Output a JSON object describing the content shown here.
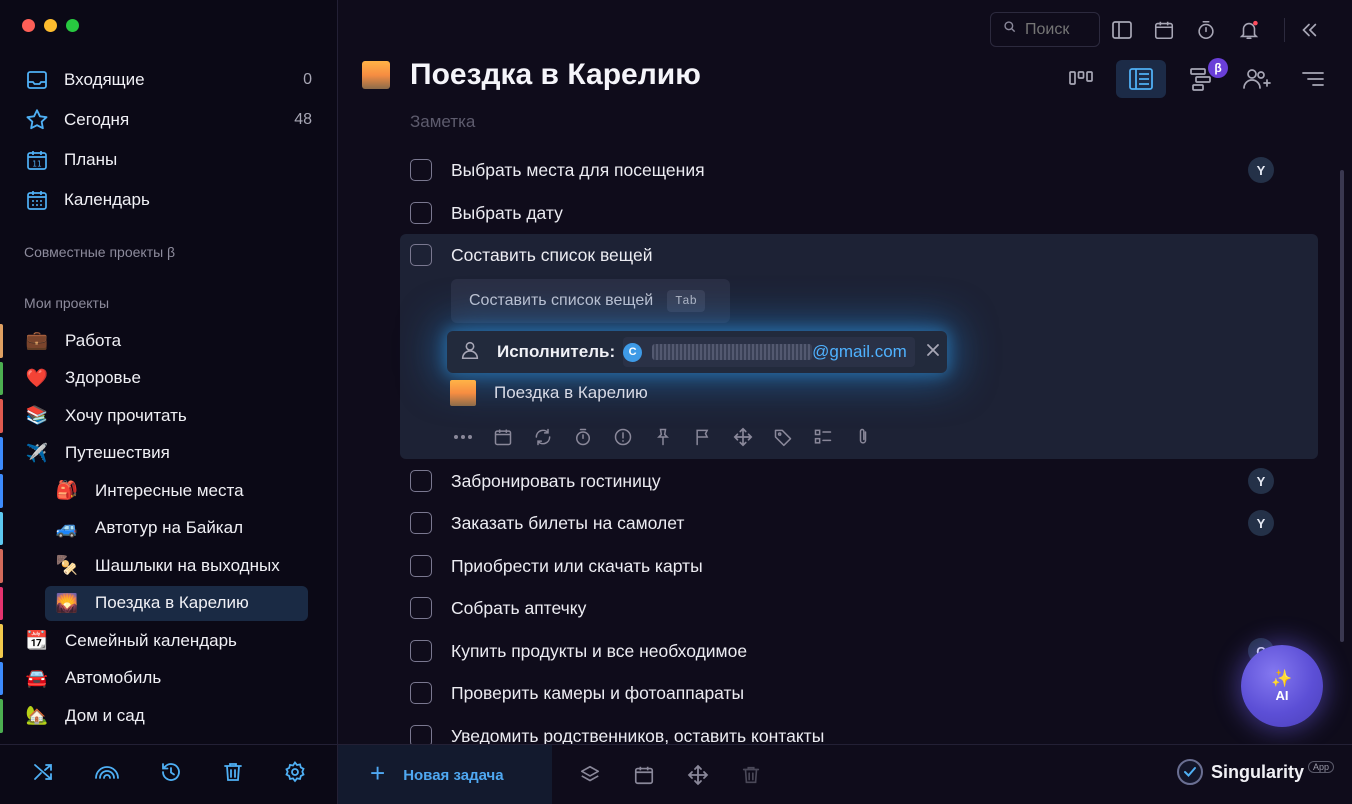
{
  "window": {
    "traffic_colors": [
      "#fe5f57",
      "#febc2e",
      "#28c840"
    ]
  },
  "sidebar": {
    "nav": [
      {
        "label": "Входящие",
        "count": "0",
        "icon": "inbox-icon"
      },
      {
        "label": "Сегодня",
        "count": "48",
        "icon": "star-icon"
      },
      {
        "label": "Планы",
        "count": "",
        "icon": "calendar-day-icon"
      },
      {
        "label": "Календарь",
        "count": "",
        "icon": "calendar-grid-icon"
      }
    ],
    "shared_heading": "Совместные проекты β",
    "my_heading": "Мои проекты",
    "projects": [
      {
        "label": "Работа",
        "emoji": "💼",
        "color": "#e0a062",
        "child": false
      },
      {
        "label": "Здоровье",
        "emoji": "❤️",
        "color": "#4caf50",
        "child": false
      },
      {
        "label": "Хочу прочитать",
        "emoji": "📚",
        "color": "#e05a4f",
        "child": false
      },
      {
        "label": "Путешествия",
        "emoji": "✈️",
        "color": "#3d8bfd",
        "child": false
      },
      {
        "label": "Интересные места",
        "emoji": "🎒",
        "color": "#3d8bfd",
        "child": true
      },
      {
        "label": "Автотур на Байкал",
        "emoji": "🚙",
        "color": "#5dc8f0",
        "child": true
      },
      {
        "label": "Шашлыки на выходных",
        "emoji": "🍢",
        "color": "#d46a5a",
        "child": true
      },
      {
        "label": "Поездка в Карелию",
        "emoji": "🌄",
        "color": "#e5336e",
        "child": true,
        "active": true
      },
      {
        "label": "Семейный календарь",
        "emoji": "📆",
        "color": "#f2c94c",
        "child": false
      },
      {
        "label": "Автомобиль",
        "emoji": "🚘",
        "color": "#3d8bfd",
        "child": false
      },
      {
        "label": "Дом и сад",
        "emoji": "🏡",
        "color": "#4caf50",
        "child": false
      }
    ]
  },
  "topbar": {
    "search_placeholder": "Поиск"
  },
  "project": {
    "title": "Поездка в Карелию",
    "note_placeholder": "Заметка",
    "beta_badge": "β"
  },
  "tasks": [
    {
      "label": "Выбрать места для посещения",
      "avatar": "Y"
    },
    {
      "label": "Выбрать дату",
      "avatar": ""
    },
    {
      "label": "Составить список вещей",
      "avatar": ""
    },
    {
      "label": "Забронировать гостиницу",
      "avatar": "Y"
    },
    {
      "label": "Заказать билеты на самолет",
      "avatar": "Y"
    },
    {
      "label": "Приобрести или скачать карты",
      "avatar": ""
    },
    {
      "label": "Собрать аптечку",
      "avatar": ""
    },
    {
      "label": "Купить продукты и все необходимое",
      "avatar": "C"
    },
    {
      "label": "Проверить камеры и фотоаппараты",
      "avatar": ""
    },
    {
      "label": "Уведомить родственников, оставить контакты",
      "avatar": ""
    }
  ],
  "editor": {
    "suggestion": "Составить список вещей",
    "suggestion_key": "Tab",
    "assignee_label": "Исполнитель:",
    "assignee_initial": "C",
    "assignee_email_domain": "@gmail.com",
    "project_name": "Поездка в Карелию"
  },
  "ai_button": {
    "label": "AI"
  },
  "footer": {
    "new_task": "Новая задача",
    "brand": "Singularity",
    "brand_badge": "App"
  }
}
